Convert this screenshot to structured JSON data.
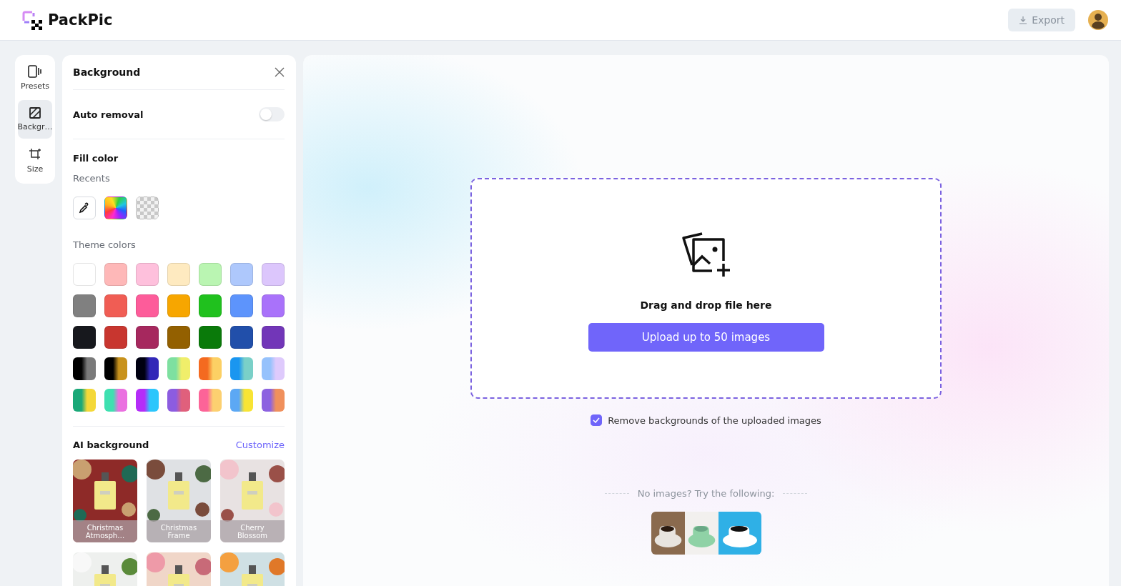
{
  "header": {
    "logo": "PackPic",
    "export_button": {
      "label": "Export",
      "disabled": true
    }
  },
  "rail": [
    {
      "label": "Presets",
      "kind": "presets",
      "selected": false
    },
    {
      "label": "Backgr…",
      "kind": "background",
      "selected": true
    },
    {
      "label": "Size",
      "kind": "size",
      "selected": false
    }
  ],
  "panel": {
    "title": "Background",
    "auto_removal": {
      "label": "Auto removal",
      "on": false
    },
    "fill_color": {
      "title": "Fill color",
      "recents_label": "Recents",
      "recents": [
        {
          "kind": "picker"
        },
        {
          "kind": "rainbow"
        },
        {
          "kind": "transparent"
        }
      ],
      "theme_label": "Theme colors",
      "theme_colors": [
        {
          "kind": "solid",
          "color": "#ffffff"
        },
        {
          "kind": "solid",
          "color": "#feb8b8"
        },
        {
          "kind": "solid",
          "color": "#fec0dc"
        },
        {
          "kind": "solid",
          "color": "#feeac0"
        },
        {
          "kind": "solid",
          "color": "#baf5b2"
        },
        {
          "kind": "solid",
          "color": "#aec8fc"
        },
        {
          "kind": "solid",
          "color": "#dcc6fc"
        },
        {
          "kind": "solid",
          "color": "#808080"
        },
        {
          "kind": "solid",
          "color": "#f05d54"
        },
        {
          "kind": "solid",
          "color": "#fd5c9a"
        },
        {
          "kind": "solid",
          "color": "#f7a600"
        },
        {
          "kind": "solid",
          "color": "#20c11e"
        },
        {
          "kind": "solid",
          "color": "#5d94fc"
        },
        {
          "kind": "solid",
          "color": "#a972fa"
        },
        {
          "kind": "solid",
          "color": "#17181d"
        },
        {
          "kind": "solid",
          "color": "#c8362f"
        },
        {
          "kind": "solid",
          "color": "#a6285e"
        },
        {
          "kind": "solid",
          "color": "#936000"
        },
        {
          "kind": "solid",
          "color": "#0a7a0a"
        },
        {
          "kind": "solid",
          "color": "#214faa"
        },
        {
          "kind": "solid",
          "color": "#7236b8"
        },
        {
          "kind": "gradient",
          "stops": [
            {
              "color": "#000000"
            },
            {
              "color": "#7a7a7a"
            }
          ]
        },
        {
          "kind": "gradient",
          "stops": [
            {
              "color": "#000000"
            },
            {
              "color": "#c8921c"
            }
          ]
        },
        {
          "kind": "gradient",
          "stops": [
            {
              "color": "#000010"
            },
            {
              "color": "#3228b8"
            }
          ]
        },
        {
          "kind": "gradient",
          "stops": [
            {
              "color": "#7ee0a0"
            },
            {
              "color": "#f0ee6a"
            }
          ]
        },
        {
          "kind": "gradient",
          "stops": [
            {
              "color": "#f46a20"
            },
            {
              "color": "#fcd064"
            }
          ]
        },
        {
          "kind": "gradient",
          "stops": [
            {
              "color": "#1a96f0"
            },
            {
              "color": "#7ad0c8"
            }
          ]
        },
        {
          "kind": "gradient",
          "stops": [
            {
              "color": "#96c2fc"
            },
            {
              "color": "#decafc"
            }
          ]
        },
        {
          "kind": "gradient",
          "stops": [
            {
              "color": "#1aa878"
            },
            {
              "color": "#f4d838"
            }
          ]
        },
        {
          "kind": "gradient",
          "stops": [
            {
              "color": "#3ee0b0"
            },
            {
              "color": "#ea70e0"
            }
          ]
        },
        {
          "kind": "gradient",
          "stops": [
            {
              "color": "#b42cf8"
            },
            {
              "color": "#2cc6fc"
            }
          ]
        },
        {
          "kind": "gradient",
          "stops": [
            {
              "color": "#8c5ce0"
            },
            {
              "color": "#e0607c"
            }
          ]
        },
        {
          "kind": "gradient",
          "stops": [
            {
              "color": "#fc6498"
            },
            {
              "color": "#fcd070"
            }
          ]
        },
        {
          "kind": "gradient",
          "stops": [
            {
              "color": "#5ca8f4"
            },
            {
              "color": "#f8e434"
            }
          ]
        },
        {
          "kind": "gradient",
          "stops": [
            {
              "color": "#8c62e0"
            },
            {
              "color": "#f0905c"
            }
          ]
        }
      ]
    },
    "ai_background": {
      "title": "AI background",
      "link": "Customize",
      "cards": [
        {
          "label": "Christmas Atmosph…",
          "kind": "picture"
        },
        {
          "label": "Christmas Frame",
          "kind": "picture"
        },
        {
          "label": "Cherry Blossom",
          "kind": "picture"
        },
        {
          "kind": "picture"
        },
        {
          "kind": "picture"
        },
        {
          "kind": "picture"
        }
      ]
    }
  },
  "upload": {
    "heading": "Drag and drop file here",
    "button": "Upload up to 50 images",
    "remove_bg": {
      "label": "Remove backgrounds of the uploaded images",
      "checked": true
    },
    "samples_label": "No images? Try the following:",
    "samples": [
      {
        "kind": "picture"
      },
      {
        "kind": "picture"
      },
      {
        "kind": "picture"
      }
    ]
  }
}
